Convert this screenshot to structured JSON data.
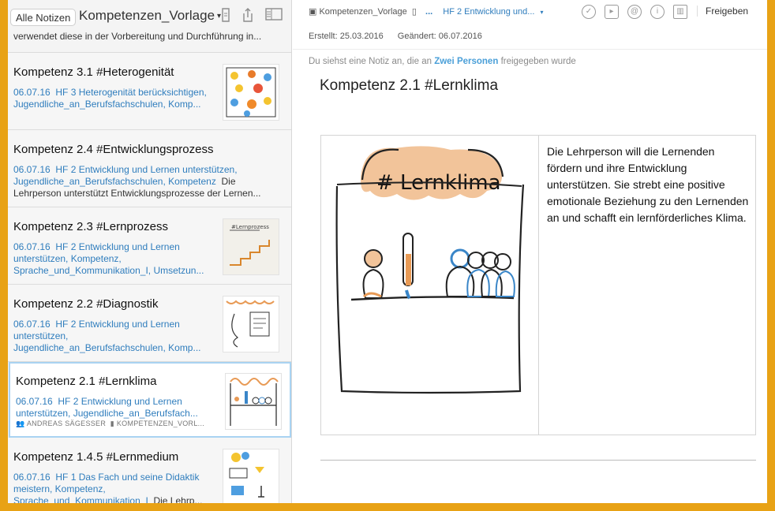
{
  "sidebar": {
    "all_notes_label": "Alle Notizen",
    "notebook_title": "Kompetenzen_Vorlage",
    "partial_text": "verwendet diese in der Vorbereitung und Durchführung in...",
    "notes": [
      {
        "title": "Kompetenz 3.1 #Heterogenität",
        "date": "06.07.16",
        "tags": "HF 3 Heterogenität berücksichtigen, Jugendliche_an_Berufsfachschulen, Komp...",
        "snippet": ""
      },
      {
        "title": "Kompetenz 2.4 #Entwicklungsprozess",
        "date": "06.07.16",
        "tags": "HF 2 Entwicklung und Lernen unterstützen, Jugendliche_an_Berufsfachschulen, Kompetenz",
        "snippet": "Die Lehrperson unterstützt Entwicklungsprozesse der Lernen..."
      },
      {
        "title": "Kompetenz 2.3 #Lernprozess",
        "date": "06.07.16",
        "tags": "HF 2 Entwicklung und Lernen unterstützen, Kompetenz, Sprache_und_Kommunikation_I, Umsetzun...",
        "snippet": ""
      },
      {
        "title": "Kompetenz 2.2 #Diagnostik",
        "date": "06.07.16",
        "tags": "HF 2 Entwicklung und Lernen unterstützen, Jugendliche_an_Berufsfachschulen, Komp...",
        "snippet": ""
      },
      {
        "title": "Kompetenz 2.1 #Lernklima",
        "date": "06.07.16",
        "tags": "HF 2 Entwicklung und Lernen unterstützen, Jugendliche_an_Berufsfach...",
        "snippet": "",
        "author": "ANDREAS SÄGESSER",
        "notebook": "KOMPETENZEN_VORL..."
      },
      {
        "title": "Kompetenz 1.4.5 #Lernmedium",
        "date": "06.07.16",
        "tags": "HF 1 Das Fach und seine Didaktik meistern, Kompetenz, Sprache_und_Kommunikation_I",
        "snippet": "Die Lehrp..."
      }
    ]
  },
  "main": {
    "breadcrumb_notebook": "Kompetenzen_Vorlage",
    "breadcrumb_more": "...",
    "breadcrumb_tag": "HF 2 Entwicklung und...",
    "share_label": "Freigeben",
    "created": "Erstellt: 25.03.2016",
    "changed": "Geändert: 06.07.2016",
    "share_prefix": "Du siehst eine Notiz an, die an",
    "share_people": "Zwei Personen",
    "share_suffix": "freigegeben wurde",
    "note_title": "Kompetenz 2.1 #Lernklima",
    "sketch_caption": "# Lernklima",
    "body_text": "Die Lehrperson will die Lernenden fördern und ihre Entwicklung unterstützen. Sie strebt eine positive emotionale Beziehung zu den Lernenden an und schafft ein lernförderliches Klima."
  },
  "colors": {
    "accent": "#2f7dbd",
    "frame": "#e8a215",
    "sketch_orange": "#e89a55",
    "sketch_blue": "#3a86c8"
  }
}
